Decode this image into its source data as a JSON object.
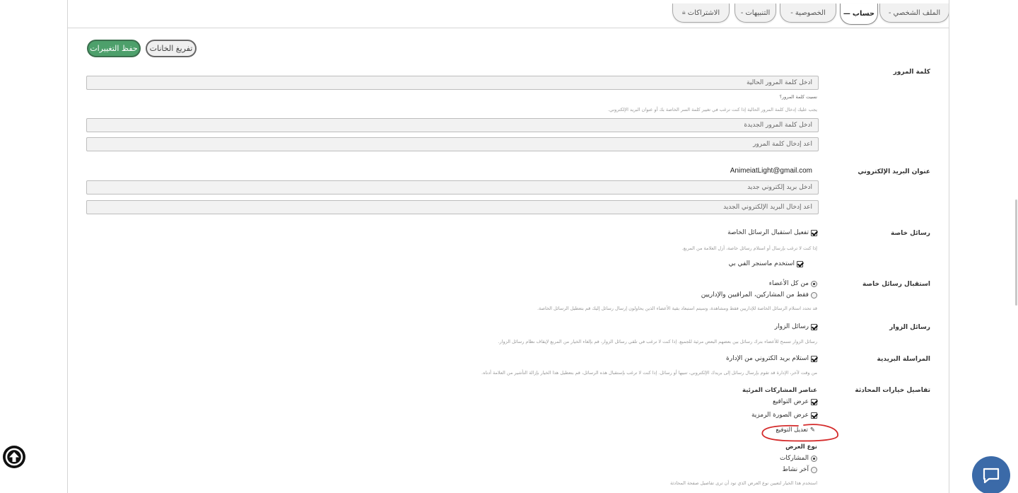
{
  "tabs": [
    {
      "label": "الملف الشخصي",
      "active": false
    },
    {
      "label": "حساب",
      "active": true
    },
    {
      "label": "الخصوصية",
      "active": false
    },
    {
      "label": "التنبيهات",
      "active": false
    },
    {
      "label": "الاشتراكات",
      "active": false,
      "icon": "lock-icon"
    }
  ],
  "buttons": {
    "save": "حفظ التغييرات",
    "clear": "تفريغ الخانات"
  },
  "password": {
    "label": "كلمة المرور",
    "current_placeholder": "ادخل كلمة المرور الحالية",
    "forgot": "نسيت كلمة المرور؟",
    "hint": "يجب عليك إدخال كلمة المرور الحالية إذا كنت ترغب في تغيير كلمة السر الخاصة بك أو عنوان البريد الإلكتروني.",
    "new_placeholder": "ادخل كلمة المرور الجديدة",
    "confirm_placeholder": "أعد إدخال كلمة المرور"
  },
  "email": {
    "label": "عنوان البريد الإلكتروني",
    "value": "AnimeiatLight@gmail.com",
    "new_placeholder": "ادخل بريد إلكتروني جديد",
    "confirm_placeholder": "أعد إدخال البريد الإلكتروني الجديد"
  },
  "private_messages": {
    "label": "رسائل خاصة",
    "enable": "تفعيل استقبال الرسائل الخاصة",
    "hint": "إذا كنت لا ترغب بإرسال أو استلام رسائل خاصة، أزل العلامة من المربع.",
    "messenger": "استخدم ماسنجر الفي بي"
  },
  "receive_messages": {
    "label": "استقبال رسائل خاصة",
    "option_all": "من كل الأعضاء",
    "option_staff": "فقط من المشاركين، المراقبين والإداريين",
    "hint": "قد تحدد استلام الرسائل الخاصة للإداريين فقط ومشاهدة، وسيتم استبعاد بقية الأعضاء الذين يحاولون إرسال رسائل إليك قم بتعطيل الرسائل الخاصة."
  },
  "visitor_messages": {
    "label": "رسائل الزوار",
    "enable": "رسائل الزوار",
    "hint": "رسائل الزوار تسمح للأعضاء بترك رسائل بين بعضهم البعض مرئية للجميع. إذا كنت لا ترغب في تلقي رسائل الزوار، قم بإلغاء الخيار من المربع لإيقاف نظام رسائل الزوار."
  },
  "mail_settings": {
    "label": "المراسلة البريدية",
    "enable": "استلام بريد الكتروني من الإدارة",
    "hint": "من وقت لآخر، الإدارة قد تقوم بإرسال رسائل إلى بريدك الإلكتروني، تنبيها أو رسائل. إذا كنت لا ترغب بإستقبال هذه الرسائل، قم بتعطيل هذا الخيار بإزالة التأشير من العلامة أدناه."
  },
  "thread_options": {
    "label": "تفاصيل خيارات المحادثة",
    "visible_elements_title": "عناصر المشاركات المرئية",
    "show_signatures": "عرض التواقيع",
    "show_avatars": "عرض الصورة الرمزية",
    "edit_signature": "تعديل التوقيع",
    "display_mode_title": "نوع العرض",
    "mode_posts": "المشاركات",
    "mode_last_active": "آخر نشاط",
    "mode_hint": "استخدم هذا الخيار لتعيين نوع العرض الذي تود أن ترى تفاصيل صفحة المحادثة"
  },
  "colors": {
    "save_button": "#4da06b",
    "annotation_circle": "#d42a2a",
    "chat_button": "#3b6aa8"
  }
}
